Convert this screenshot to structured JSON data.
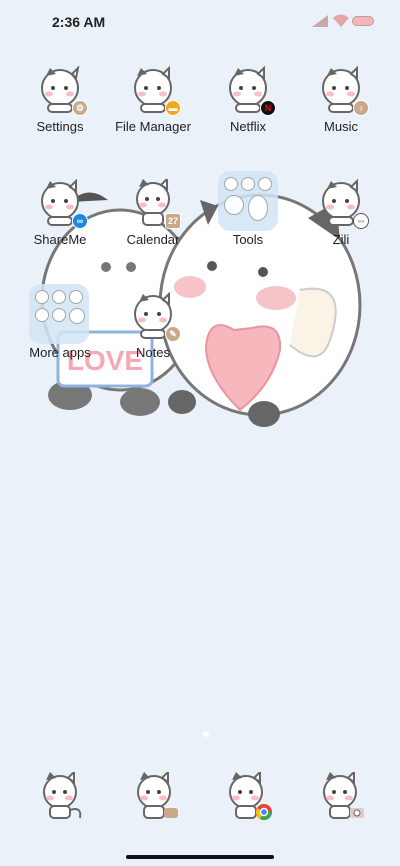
{
  "status_bar": {
    "time": "2:36 AM"
  },
  "apps": [
    {
      "name": "settings",
      "label": "Settings",
      "badge": "gear-icon",
      "badge_color": "#c9a98a"
    },
    {
      "name": "file-manager",
      "label": "File Manager",
      "badge": "folder-icon",
      "badge_color": "#f5a623"
    },
    {
      "name": "netflix",
      "label": "Netflix",
      "badge": "netflix-icon",
      "badge_color": "#b20710"
    },
    {
      "name": "music",
      "label": "Music",
      "badge": "music-note-icon",
      "badge_color": "#c9a98a"
    },
    {
      "name": "shareme",
      "label": "ShareMe",
      "badge": "shareme-icon",
      "badge_color": "#1e88e5"
    },
    {
      "name": "calendar",
      "label": "Calendar",
      "badge": "calendar-icon",
      "badge_color": "#c9a98a",
      "badge_text": "27"
    },
    {
      "name": "tools",
      "label": "Tools",
      "badge": "folder-icon",
      "badge_color": ""
    },
    {
      "name": "zili",
      "label": "Zili",
      "badge": "zili-icon",
      "badge_color": "#ffffff"
    },
    {
      "name": "more-apps",
      "label": "More apps",
      "badge": "folder-icon",
      "badge_color": ""
    },
    {
      "name": "notes",
      "label": "Notes",
      "badge": "notes-icon",
      "badge_color": "#c9a98a"
    }
  ],
  "dock": [
    {
      "name": "phone",
      "badge": "phone-icon"
    },
    {
      "name": "messages",
      "badge": "message-icon"
    },
    {
      "name": "chrome",
      "badge": "chrome-icon"
    },
    {
      "name": "camera",
      "badge": "camera-icon"
    }
  ],
  "wallpaper": {
    "sign_text": "LOVE"
  },
  "colors": {
    "background": "#eaf1f9",
    "accent_pink": "#f4a9b4",
    "battery": "#f3b7b7"
  }
}
